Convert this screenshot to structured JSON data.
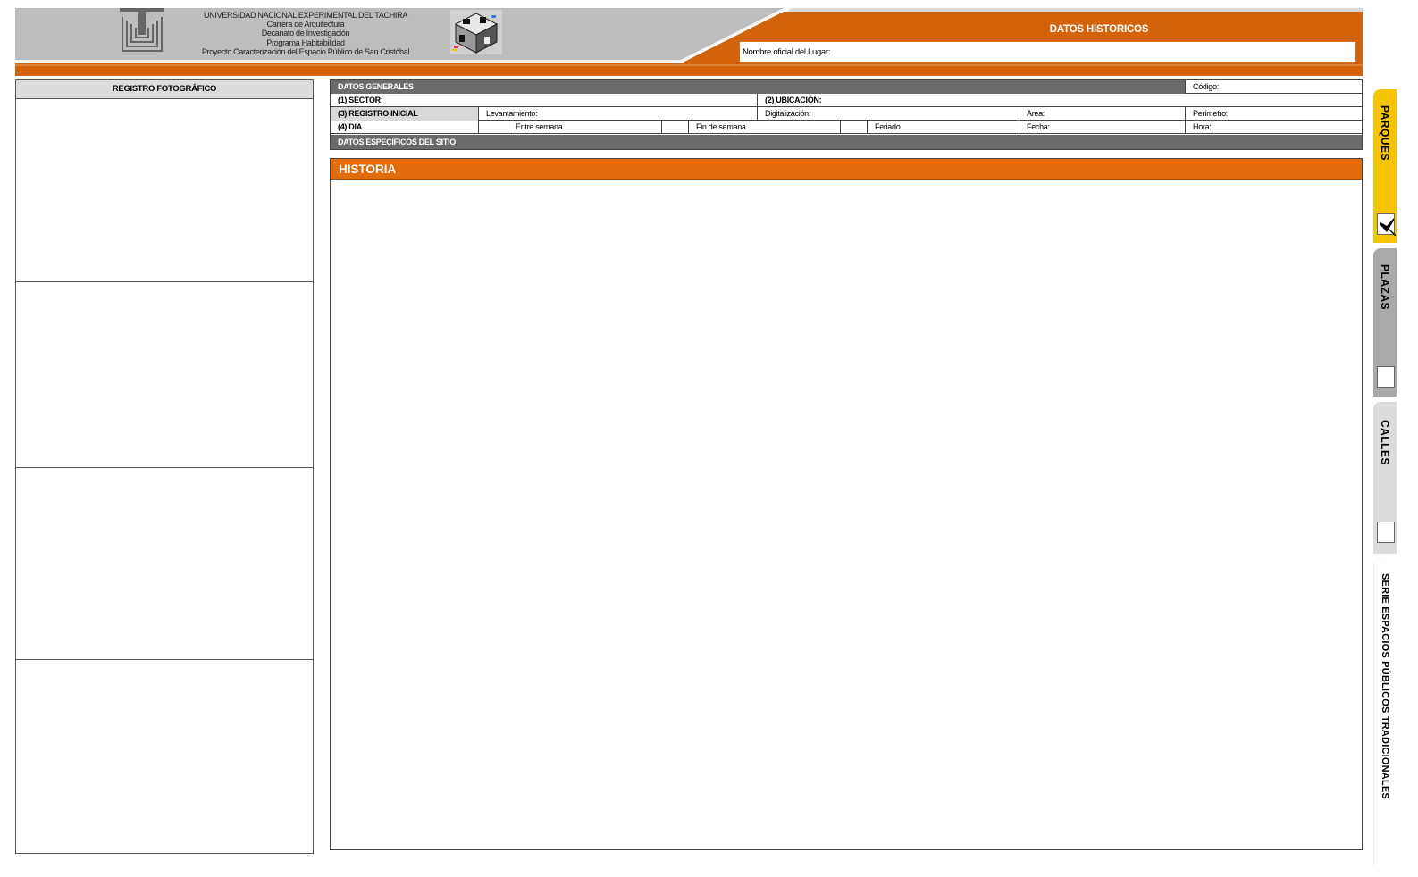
{
  "header": {
    "institution_lines": [
      "UNIVERSIDAD NACIONAL EXPERIMENTAL DEL TACHIRA",
      "Carrera de Arquitectura",
      "Decanato de Investigación",
      "Programa Habitabilidad",
      "Proyecto Caracterización del Espacio Público de San Cristóbal"
    ],
    "section_title": "DATOS HISTORICOS",
    "place_name_label": "Nombre oficial del Lugar:"
  },
  "photos": {
    "title": "REGISTRO FOTOGRÁFICO"
  },
  "general_data": {
    "title": "DATOS GENERALES",
    "code_label": "Código:",
    "sector_label": "(1) SECTOR:",
    "location_label": "(2) UBICACIÓN:",
    "initial_record_label": "(3) REGISTRO INICIAL",
    "survey_label": "Levantamiento:",
    "digitization_label": "Digitalización:",
    "area_label": "Area:",
    "perimeter_label": "Perímetro:",
    "day_label": "(4) DIA",
    "weekday_label": "Entre semana",
    "weekend_label": "Fin de semana",
    "holiday_label": "Feriado",
    "date_label": "Fecha:",
    "time_label": "Hora:",
    "specific_data_title": "DATOS ESPECÍFICOS DEL SITIO"
  },
  "historia": {
    "title": "HISTORIA"
  },
  "side_tabs": [
    {
      "label": "PARQUES",
      "checked": true,
      "color": "#f5c400"
    },
    {
      "label": "PLAZAS",
      "checked": false,
      "color": "#a9a9a9"
    },
    {
      "label": "CALLES",
      "checked": false,
      "color": "#dcdcdc"
    },
    {
      "label": "SERIE ESPACIOS PÚBLICOS TRADICIONALES",
      "checked": false,
      "color": "#ffffff"
    }
  ],
  "colors": {
    "accent_orange": "#d2630a",
    "header_grey": "#bdbdbd",
    "table_dark": "#6b6b6b",
    "historia_orange": "#e36c0a"
  }
}
